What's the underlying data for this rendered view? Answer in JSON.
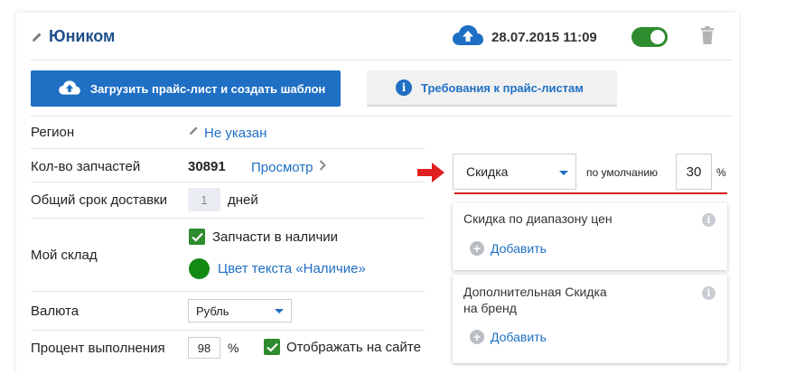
{
  "header": {
    "title": "Юником",
    "date": "28.07.2015 11:09",
    "toggle_on": true
  },
  "buttons": {
    "upload_label": "Загрузить прайс-лист и создать шаблон",
    "requirements_label": "Требования к прайс-листам",
    "info_glyph": "i"
  },
  "fields": {
    "region_label": "Регион",
    "region_value": "Не указан",
    "parts_label": "Кол-во запчастей",
    "parts_count": "30891",
    "parts_view": "Просмотр",
    "delivery_label": "Общий срок доставки",
    "delivery_value": "1",
    "delivery_unit": "дней",
    "warehouse_label": "Мой склад",
    "in_stock_label": "Запчасти в наличии",
    "in_stock_checked": true,
    "text_color_label": "Цвет текста «Наличие»",
    "text_color": "#138a13",
    "currency_label": "Валюта",
    "currency_value": "Рубль",
    "percent_label": "Процент выполнения",
    "percent_value": "98",
    "percent_unit": "%",
    "show_on_site_label": "Отображать на сайте",
    "show_on_site_checked": true
  },
  "discount": {
    "type_value": "Скидка",
    "default_label": "по умолчанию",
    "default_value": "30",
    "unit": "%",
    "panels": [
      {
        "title": "Скидка по диапазону цен",
        "add_label": "Добавить",
        "info_glyph": "i"
      },
      {
        "title_line1": "Дополнительная Скидка",
        "title_line2": "на бренд",
        "add_label": "Добавить",
        "info_glyph": "i"
      }
    ],
    "plus_glyph": "+"
  },
  "colors": {
    "accent": "#1f6fc4",
    "title": "#1f4f8a",
    "toggle": "#2e8b2e",
    "arrow": "#e02020",
    "underline": "#d9141c"
  }
}
